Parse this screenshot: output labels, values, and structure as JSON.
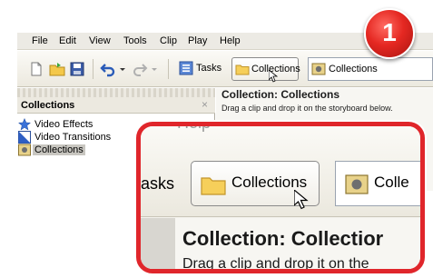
{
  "menu": [
    "File",
    "Edit",
    "View",
    "Tools",
    "Clip",
    "Play",
    "Help"
  ],
  "toolbar": {
    "tasks_label": "Tasks",
    "collections_button_label": "Collections",
    "collections_combo_label": "Collections"
  },
  "panel": {
    "title": "Collections",
    "close_glyph": "×",
    "items": [
      {
        "label": "Video Effects",
        "icon": "star-icon"
      },
      {
        "label": "Video Transitions",
        "icon": "transition-icon"
      },
      {
        "label": "Collections",
        "icon": "collections-icon",
        "selected": true
      }
    ]
  },
  "content": {
    "title": "Collection: Collections",
    "description": "Drag a clip and drop it on the storyboard below."
  },
  "badge": {
    "number": "1",
    "color": "#e52822"
  },
  "zoom": {
    "help_fragment": "Help",
    "tasks_fragment": "asks",
    "collections_label": "Collections",
    "combo_fragment": "Colle",
    "title_fragment": "Collection: Collectior",
    "desc_fragment": "Drag a clip and drop it on the"
  },
  "colors": {
    "accent": "#e0262b"
  }
}
